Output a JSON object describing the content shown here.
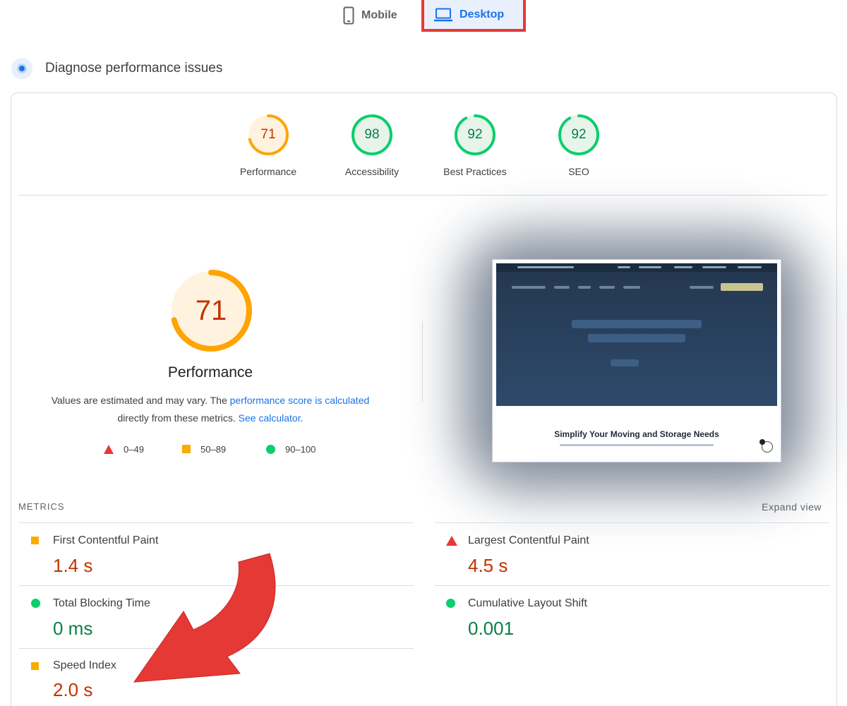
{
  "device_tabs": {
    "mobile": {
      "label": "Mobile",
      "icon": "phone-icon"
    },
    "desktop": {
      "label": "Desktop",
      "icon": "laptop-icon",
      "selected": true
    }
  },
  "section": {
    "title": "Diagnose performance issues",
    "icon": "diagnose-icon"
  },
  "scores": [
    {
      "label": "Performance",
      "value": "71",
      "score": 71,
      "color": "#ffa400",
      "text_color": "#c33300",
      "fill": "#fff3e0"
    },
    {
      "label": "Accessibility",
      "value": "98",
      "score": 98,
      "color": "#0cce6b",
      "text_color": "#0b8043",
      "fill": "#e6f4ea"
    },
    {
      "label": "Best Practices",
      "value": "92",
      "score": 92,
      "color": "#0cce6b",
      "text_color": "#0b8043",
      "fill": "#e6f4ea"
    },
    {
      "label": "SEO",
      "value": "92",
      "score": 92,
      "color": "#0cce6b",
      "text_color": "#0b8043",
      "fill": "#e6f4ea"
    }
  ],
  "performance": {
    "score": "71",
    "score_value": 71,
    "title": "Performance",
    "desc_prefix": "Values are estimated and may vary. The ",
    "desc_link1": "performance score is calculated",
    "desc_mid": "directly from these metrics. ",
    "desc_link2": "See calculator",
    "desc_suffix": "."
  },
  "legend": [
    {
      "shape": "triangle",
      "label": "0–49"
    },
    {
      "shape": "square",
      "label": "50–89"
    },
    {
      "shape": "circle",
      "label": "90–100"
    }
  ],
  "screenshot": {
    "footer_title": "Simplify Your Moving and Storage Needs"
  },
  "metrics": {
    "label": "METRICS",
    "expand": "Expand view",
    "items": [
      {
        "name": "First Contentful Paint",
        "value": "1.4 s",
        "rating": "average"
      },
      {
        "name": "Largest Contentful Paint",
        "value": "4.5 s",
        "rating": "poor"
      },
      {
        "name": "Total Blocking Time",
        "value": "0 ms",
        "rating": "good"
      },
      {
        "name": "Cumulative Layout Shift",
        "value": "0.001",
        "rating": "good"
      },
      {
        "name": "Speed Index",
        "value": "2.0 s",
        "rating": "average"
      }
    ]
  },
  "colors": {
    "pass": "#0cce6b",
    "average": "#ffa400",
    "fail": "#e53935",
    "accent": "#1a73e8",
    "annotation_arrow": "#e53935"
  }
}
